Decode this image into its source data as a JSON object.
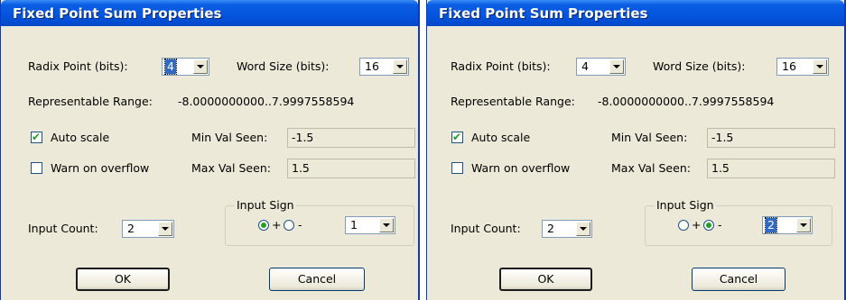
{
  "dialogs": [
    {
      "title": "Fixed Point Sum Properties",
      "radix_label": "Radix Point (bits):",
      "radix_value": "4",
      "word_label": "Word Size (bits):",
      "word_value": "16",
      "range_label": "Representable Range:",
      "range_value": "-8.0000000000..7.9997558594",
      "auto_scale_label": "Auto scale",
      "auto_scale_checked": true,
      "warn_label": "Warn on overflow",
      "warn_checked": false,
      "min_label": "Min Val Seen:",
      "min_value": "-1.5",
      "max_label": "Max Val Seen:",
      "max_value": "1.5",
      "input_count_label": "Input Count:",
      "input_count_value": "2",
      "input_sign_label": "Input Sign",
      "plus_label": "+",
      "minus_label": "-",
      "sign_selected": "plus",
      "sign_index_value": "1",
      "ok_label": "OK",
      "cancel_label": "Cancel"
    },
    {
      "title": "Fixed Point Sum Properties",
      "radix_label": "Radix Point (bits):",
      "radix_value": "4",
      "word_label": "Word Size (bits):",
      "word_value": "16",
      "range_label": "Representable Range:",
      "range_value": "-8.0000000000..7.9997558594",
      "auto_scale_label": "Auto scale",
      "auto_scale_checked": true,
      "warn_label": "Warn on overflow",
      "warn_checked": false,
      "min_label": "Min Val Seen:",
      "min_value": "-1.5",
      "max_label": "Max Val Seen:",
      "max_value": "1.5",
      "input_count_label": "Input Count:",
      "input_count_value": "2",
      "input_sign_label": "Input Sign",
      "plus_label": "+",
      "minus_label": "-",
      "sign_selected": "minus",
      "sign_index_value": "2",
      "ok_label": "OK",
      "cancel_label": "Cancel"
    }
  ],
  "colors": {
    "title_bar": "#0554dd",
    "dialog_bg": "#ece9d8",
    "selection": "#316ac5",
    "check_mark": "#21a121"
  }
}
